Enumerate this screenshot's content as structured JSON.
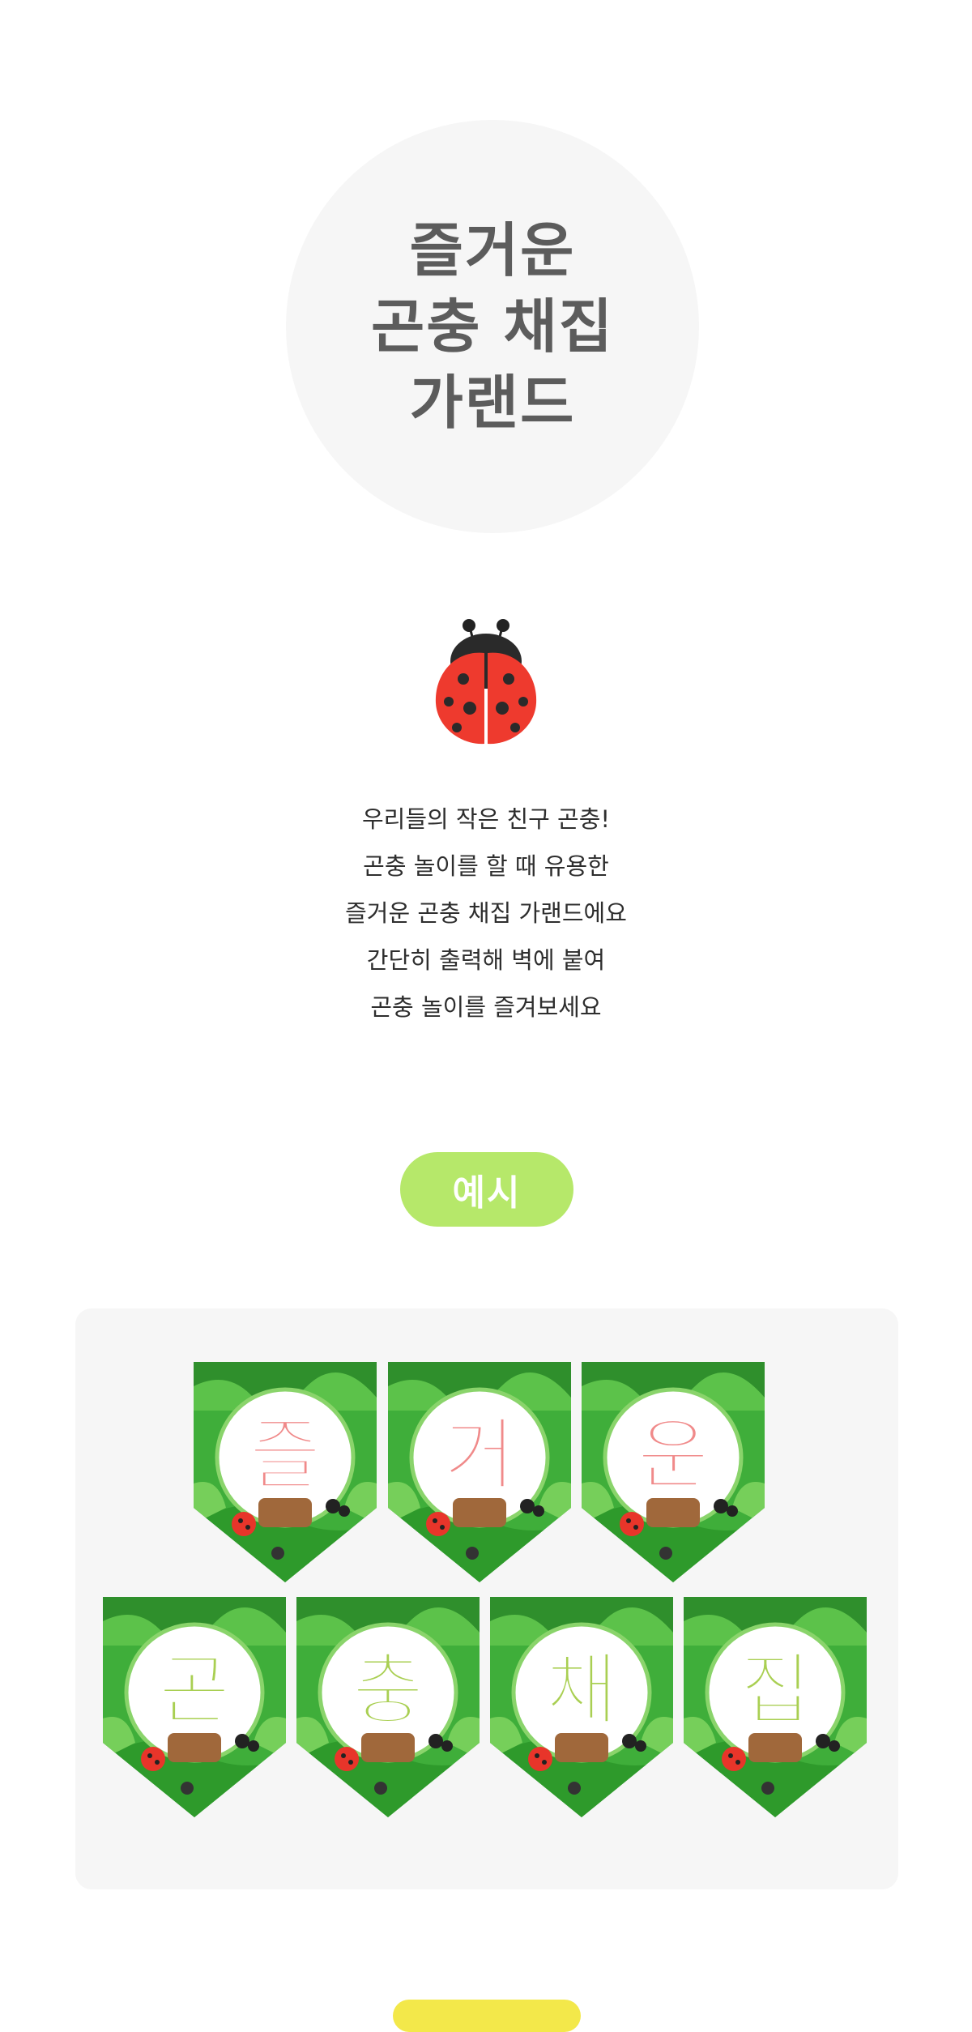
{
  "title": {
    "lines": [
      "즐거운",
      "곤충 채집",
      "가랜드"
    ]
  },
  "icons": {
    "ladybug": "ladybug-icon"
  },
  "description": {
    "lines": [
      "우리들의 작은 친구 곤충!",
      "곤충 놀이를 할 때 유용한",
      "즐거운 곤충 채집 가랜드에요",
      "간단히 출력해 벽에 붙여",
      "곤충 놀이를 즐겨보세요"
    ]
  },
  "example_label": "예시",
  "garland": {
    "row1": [
      "즐",
      "거",
      "운"
    ],
    "row2": [
      "곤",
      "충",
      "채",
      "집"
    ]
  },
  "colors": {
    "title_circle": "#f6f6f6",
    "title_text": "#5c5c5c",
    "pill": "#b6e86a",
    "panel": "#f6f6f6",
    "pennant_green": "#3fae3a",
    "letter_row1": "#f08a8a",
    "letter_row2": "#a9cf52"
  }
}
